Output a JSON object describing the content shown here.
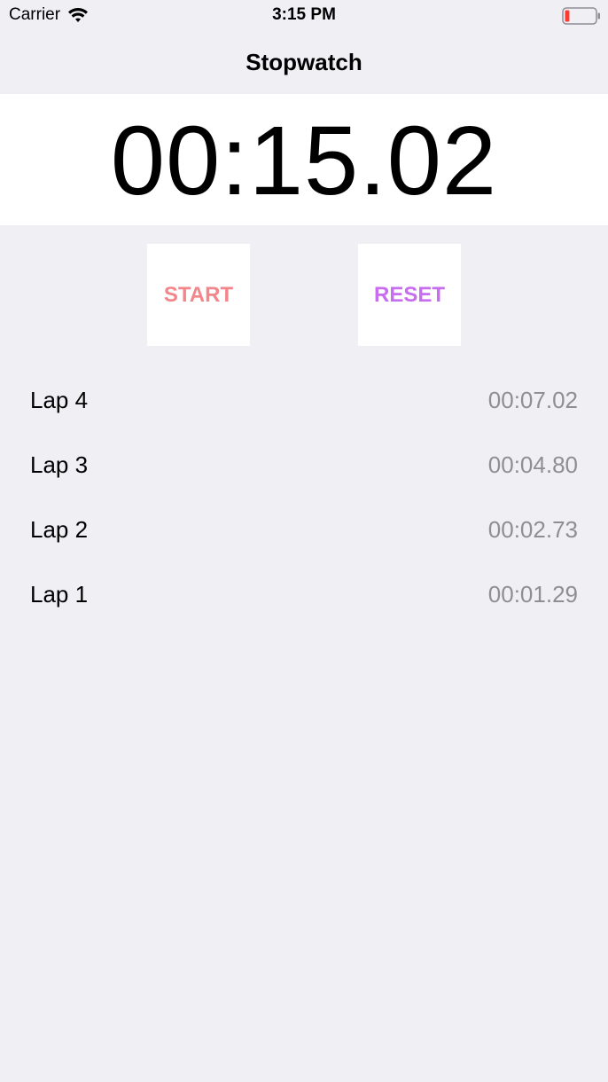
{
  "status_bar": {
    "carrier": "Carrier",
    "time": "3:15 PM",
    "wifi_icon": "wifi-icon",
    "battery_icon": "battery-low-icon",
    "battery_level": 0.15,
    "battery_color": "#ff3b30"
  },
  "nav": {
    "title": "Stopwatch"
  },
  "timer": {
    "display": "00:15.02"
  },
  "controls": {
    "start_label": "START",
    "start_color": "#f2868a",
    "reset_label": "RESET",
    "reset_color": "#c86cf0"
  },
  "laps": [
    {
      "label": "Lap 4",
      "time": "00:07.02"
    },
    {
      "label": "Lap 3",
      "time": "00:04.80"
    },
    {
      "label": "Lap 2",
      "time": "00:02.73"
    },
    {
      "label": "Lap 1",
      "time": "00:01.29"
    }
  ]
}
